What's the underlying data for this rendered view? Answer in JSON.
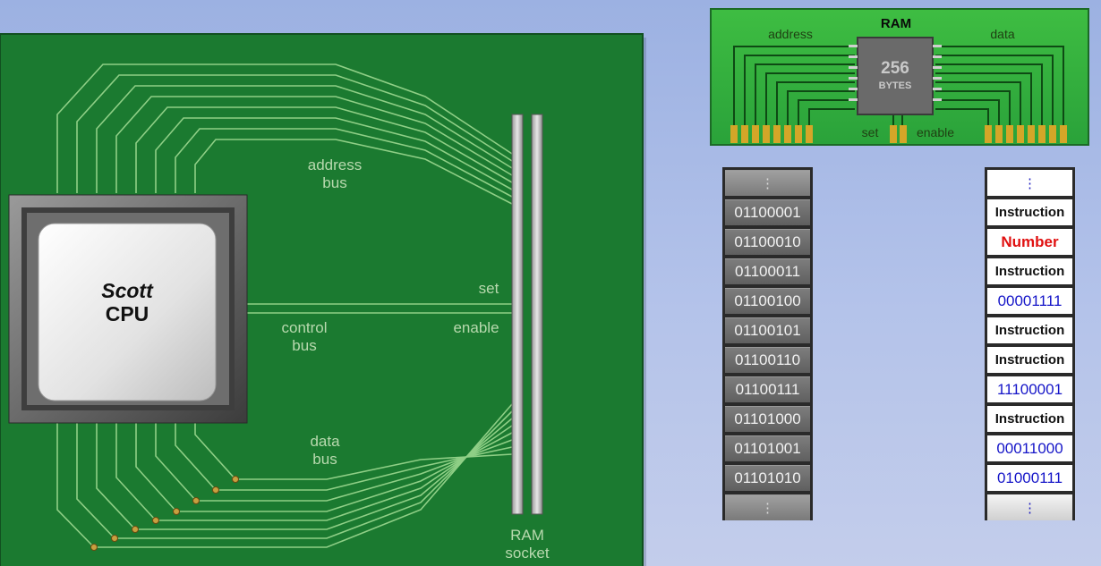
{
  "cpu": {
    "name": "Scott",
    "label": "CPU"
  },
  "board_labels": {
    "address_bus": [
      "address",
      "bus"
    ],
    "control_bus": [
      "control",
      "bus"
    ],
    "data_bus": [
      "data",
      "bus"
    ],
    "set": "set",
    "enable": "enable",
    "ram_socket": [
      "RAM",
      "socket"
    ]
  },
  "ram_module": {
    "title": "RAM",
    "address": "address",
    "data": "data",
    "size": "256",
    "unit": "BYTES",
    "set": "set",
    "enable": "enable"
  },
  "address_column": {
    "top": "⋮",
    "addresses": [
      "01100001",
      "01100010",
      "01100011",
      "01100100",
      "01100101",
      "01100110",
      "01100111",
      "01101000",
      "01101001",
      "01101010"
    ],
    "bottom": "⋮"
  },
  "data_column": {
    "top": "⋮",
    "values": [
      {
        "text": "Instruction",
        "kind": "instr"
      },
      {
        "text": "Number",
        "kind": "num"
      },
      {
        "text": "Instruction",
        "kind": "instr"
      },
      {
        "text": "00001111",
        "kind": "bin"
      },
      {
        "text": "Instruction",
        "kind": "instr"
      },
      {
        "text": "Instruction",
        "kind": "instr"
      },
      {
        "text": "11100001",
        "kind": "bin"
      },
      {
        "text": "Instruction",
        "kind": "instr"
      },
      {
        "text": "00011000",
        "kind": "bin"
      },
      {
        "text": "01000111",
        "kind": "bin"
      }
    ],
    "bottom": "⋮"
  },
  "colors": {
    "board": "#1b7a30",
    "trace": "#8fcf86",
    "number_red": "#e01010",
    "binary_blue": "#1515c8"
  }
}
